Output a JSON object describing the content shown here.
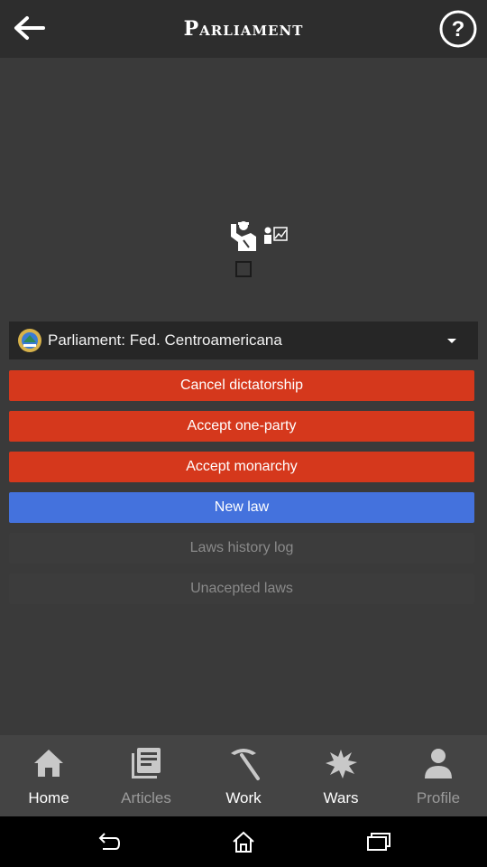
{
  "header": {
    "title": "Parliament",
    "back_icon": "arrow-left-icon",
    "help_icon": "help-circle-icon"
  },
  "parliament_graphic": {
    "icon": "parliament-seats-icon",
    "checkbox_checked": false
  },
  "selector": {
    "label": "Parliament: Fed. Centroamericana",
    "flag_icon": "country-flag-icon",
    "caret_icon": "caret-down-icon"
  },
  "actions": {
    "cancel_dictatorship": "Cancel dictatorship",
    "accept_one_party": "Accept one-party",
    "accept_monarchy": "Accept monarchy",
    "new_law": "New law",
    "laws_history_log": "Laws history log",
    "unaccepted_laws": "Unacepted laws"
  },
  "bottom_nav": {
    "items": [
      {
        "label": "Home",
        "icon": "home-icon",
        "active": true
      },
      {
        "label": "Articles",
        "icon": "articles-icon",
        "active": false
      },
      {
        "label": "Work",
        "icon": "pickaxe-icon",
        "active": true
      },
      {
        "label": "Wars",
        "icon": "explosion-icon",
        "active": true
      },
      {
        "label": "Profile",
        "icon": "person-icon",
        "active": false
      }
    ]
  },
  "colors": {
    "danger": "#d5381c",
    "primary": "#4472dd",
    "background": "#3a3a3a",
    "topbar": "#2d2d2d"
  }
}
